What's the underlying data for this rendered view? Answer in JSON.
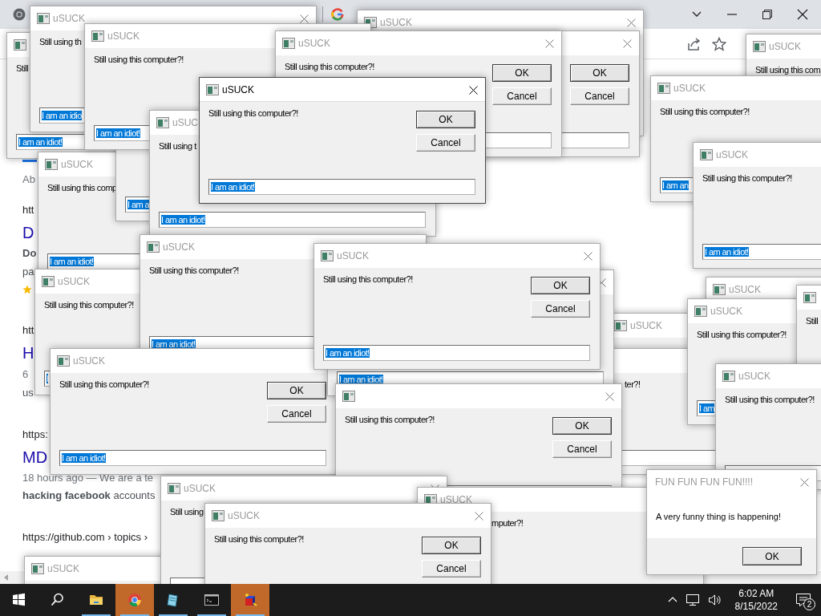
{
  "browser": {
    "results": [
      {
        "kind": "meta",
        "text": "Ab"
      },
      {
        "kind": "url",
        "text": "htt"
      },
      {
        "kind": "title",
        "text": "D"
      },
      {
        "kind": "bold",
        "text": "Do"
      },
      {
        "kind": "snippet",
        "text": "pa"
      },
      {
        "kind": "rating"
      },
      {
        "kind": "url",
        "text": "htt"
      },
      {
        "kind": "title",
        "text": "H"
      },
      {
        "kind": "meta",
        "text": "6"
      },
      {
        "kind": "snippet",
        "text": "us"
      },
      {
        "kind": "url",
        "text": "https:"
      },
      {
        "kind": "title",
        "text": "MD"
      },
      {
        "kind": "meta",
        "text": "18 hours ago — We are a te"
      },
      {
        "kind": "snippet",
        "text": "**hacking facebook** accounts"
      },
      {
        "kind": "url",
        "text": "https://github.com › topics ›"
      }
    ]
  },
  "windows": [
    {
      "kind": "prompt",
      "active": false,
      "title": "uSUCK",
      "message": "Still using th",
      "field_value": "I am an idio",
      "value_selected": true
    },
    {
      "kind": "prompt",
      "active": false,
      "title": "uSUCK"
    },
    {
      "kind": "prompt",
      "active": false,
      "title": "uSUCK",
      "message": "Still using this computer?!",
      "field_value": "I am an idiot!",
      "value_selected": true
    },
    {
      "kind": "prompt",
      "active": false,
      "message": "Still",
      "field_value": "I am an idiot!",
      "value_selected": true
    },
    {
      "kind": "prompt",
      "active": false,
      "title": "uSUCK",
      "message": "Still using this computer?!",
      "ok": "OK",
      "cancel": "Cancel"
    },
    {
      "kind": "prompt",
      "active": false,
      "ok": "OK",
      "cancel": "Cancel"
    },
    {
      "kind": "prompt",
      "active": false,
      "title": "uSUCK",
      "message": "Still using this com"
    },
    {
      "kind": "prompt",
      "active": true,
      "title": "uSUCK",
      "message": "Still using this computer?!",
      "ok": "OK",
      "cancel": "Cancel",
      "field_value": "I am an idiot!",
      "value_selected": true
    },
    {
      "kind": "prompt",
      "active": false,
      "title": "uSUCK",
      "message": "Still using this computer?!",
      "field_value": "I am an",
      "value_selected": true
    },
    {
      "kind": "prompt",
      "active": false,
      "field_value": "I am a",
      "value_selected": true
    },
    {
      "kind": "prompt",
      "active": false,
      "title": "uSUC",
      "message": "Still using t",
      "field_value": "I am an idiot!",
      "value_selected": true
    },
    {
      "kind": "prompt",
      "active": false,
      "title": "uSUCK",
      "message": "Still using this comp",
      "field_value": "I am an idiot!",
      "value_selected": true
    },
    {
      "kind": "prompt",
      "active": false,
      "title": "uSUCK",
      "message": "Still using this computer?!",
      "field_value": "I am an idiot!",
      "value_selected": true
    },
    {
      "kind": "prompt",
      "active": false,
      "title": "uSUCK",
      "message": "Still using this computer?!",
      "field_value": "I am an idiot!",
      "value_selected": true
    },
    {
      "kind": "prompt",
      "active": false,
      "title": "uSUCK",
      "message": "Still using this computer?!",
      "field_value": "I",
      "value_selected": true
    },
    {
      "kind": "prompt",
      "active": false,
      "title": "uSUCK",
      "message": "Still using this computer?!",
      "ok": "OK",
      "cancel": "Cancel",
      "field_value": "I am an idiot!",
      "value_selected": true
    },
    {
      "kind": "prompt",
      "active": false,
      "field_value": "I am an idiot!",
      "value_selected": true
    },
    {
      "kind": "prompt",
      "active": false,
      "title": "uSUCK"
    },
    {
      "kind": "prompt",
      "active": false,
      "title": "uSUCK",
      "message": "Still using this computer?!",
      "field_value": "I am",
      "value_selected": true
    },
    {
      "kind": "prompt",
      "active": false,
      "title": "uSUCK"
    },
    {
      "kind": "prompt",
      "active": false,
      "message": "Still"
    },
    {
      "kind": "prompt",
      "active": false,
      "title": "uSUCK",
      "message": "Still using this computer?!",
      "ok": "OK",
      "cancel": "Cancel",
      "field_value": "I am an idiot!",
      "value_selected": true
    },
    {
      "kind": "prompt",
      "active": false,
      "message": "ter?!"
    },
    {
      "kind": "prompt",
      "active": false,
      "title": "uSUCK",
      "message": "Still using this computer?!"
    },
    {
      "kind": "prompt",
      "active": false,
      "message": "Still using this computer?!",
      "ok": "OK",
      "cancel": "Cancel"
    },
    {
      "kind": "prompt",
      "active": false,
      "title": "uSUCK",
      "message": "Still using"
    },
    {
      "kind": "prompt",
      "active": false,
      "title": "uSUCK",
      "message": "mputer?!"
    },
    {
      "kind": "prompt",
      "active": false,
      "title": "uSUCK"
    },
    {
      "kind": "prompt",
      "active": false,
      "title": "uSUCK",
      "message": "Still using this computer?!",
      "ok": "OK",
      "cancel": "Cancel"
    },
    {
      "kind": "notice",
      "active": false,
      "title": "FUN FUN FUN FUN!!!!",
      "message": "A very funny thing is happening!",
      "ok": "OK"
    }
  ],
  "taskbar": {
    "apps": [
      {
        "kind": "start",
        "running": false,
        "flashing": false
      },
      {
        "kind": "search",
        "running": false,
        "flashing": false
      },
      {
        "kind": "folder",
        "running": true,
        "flashing": false
      },
      {
        "kind": "browser",
        "running": true,
        "flashing": true
      },
      {
        "kind": "notepad",
        "running": true,
        "flashing": false
      },
      {
        "kind": "terminal",
        "running": true,
        "flashing": false
      },
      {
        "kind": "cube",
        "running": true,
        "flashing": true
      }
    ],
    "time": "6:02 AM",
    "date": "8/15/2022",
    "notifications": "2"
  }
}
